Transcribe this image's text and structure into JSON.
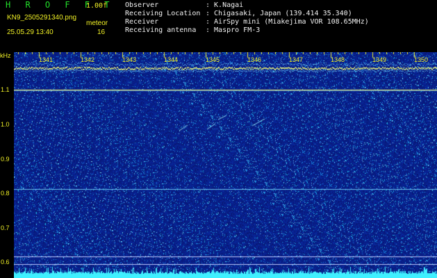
{
  "header": {
    "app_title": "H R O F F T",
    "version": "1.00f",
    "filename": "KN9_2505291340.png",
    "meteor_label": "meteor",
    "meteor_count": "16",
    "datetime": "25.05.29 13:40"
  },
  "meta": [
    {
      "key": "Observer",
      "value": ": K.Nagai"
    },
    {
      "key": "Receiving Location",
      "value": ": Chigasaki, Japan (139.414 35.340)"
    },
    {
      "key": "Receiver",
      "value": ": AirSpy mini (Miakejima VOR 108.65MHz)"
    },
    {
      "key": "Receiving antenna",
      "value": ": Maspro FM-3"
    }
  ],
  "axes": {
    "unit": "kHz",
    "y_ticks": [
      "1.1",
      "1.0",
      "0.9",
      "0.8",
      "0.7",
      "0.6"
    ],
    "x_ticks": [
      "1341",
      "1342",
      "1343",
      "1344",
      "1345",
      "1346",
      "1347",
      "1348",
      "1349",
      "1350"
    ]
  },
  "colors": {
    "background": "#000000",
    "spectrogram_base": "#0c1f8c",
    "accent_yellow": "#f2f226",
    "title_green": "#22e02a",
    "signal_cyan": "#3ff0ff"
  }
}
